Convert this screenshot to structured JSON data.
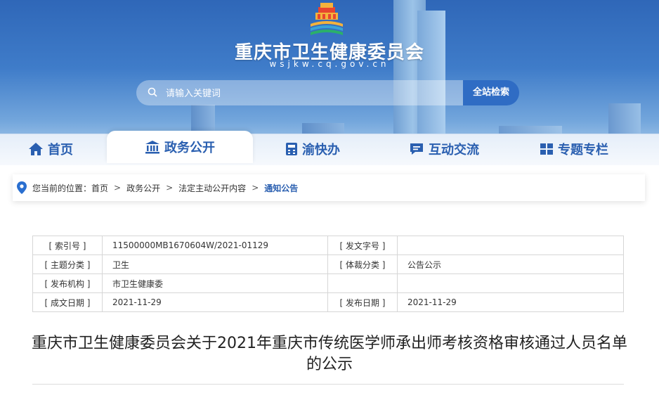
{
  "header": {
    "site_title": "重庆市卫生健康委员会",
    "domain": "wsjkw.cq.gov.cn",
    "logo_icon": "building-emblem-icon"
  },
  "search": {
    "placeholder": "请输入关键词",
    "button_label": "全站检索"
  },
  "nav": {
    "items": [
      {
        "label": "首页",
        "icon": "home-icon"
      },
      {
        "label": "政务公开",
        "icon": "government-building-icon"
      },
      {
        "label": "渝快办",
        "icon": "calculator-icon"
      },
      {
        "label": "互动交流",
        "icon": "chat-icon"
      },
      {
        "label": "专题专栏",
        "icon": "grid-icon"
      }
    ],
    "active": "政务公开"
  },
  "breadcrumb": {
    "prefix": "您当前的位置：",
    "items": [
      "首页",
      "政务公开",
      "法定主动公开内容",
      "通知公告"
    ]
  },
  "meta": {
    "index_no_label": "[ 索引号 ]",
    "index_no": "11500000MB1670604W/2021-01129",
    "doc_no_label": "[ 发文字号 ]",
    "doc_no": "",
    "topic_label": "[ 主题分类 ]",
    "topic": "卫生",
    "genre_label": "[ 体裁分类 ]",
    "genre": "公告公示",
    "issuer_label": "[ 发布机构 ]",
    "issuer": "市卫生健康委",
    "written_label": "[ 成文日期 ]",
    "written_date": "2021-11-29",
    "publish_label": "[ 发布日期 ]",
    "publish_date": "2021-11-29"
  },
  "document": {
    "title": "重庆市卫生健康委员会关于2021年重庆市传统医学师承出师考核资格审核通过人员名单的公示"
  },
  "colors": {
    "primary": "#2a5fb0",
    "search_button": "#2f6cc4"
  }
}
